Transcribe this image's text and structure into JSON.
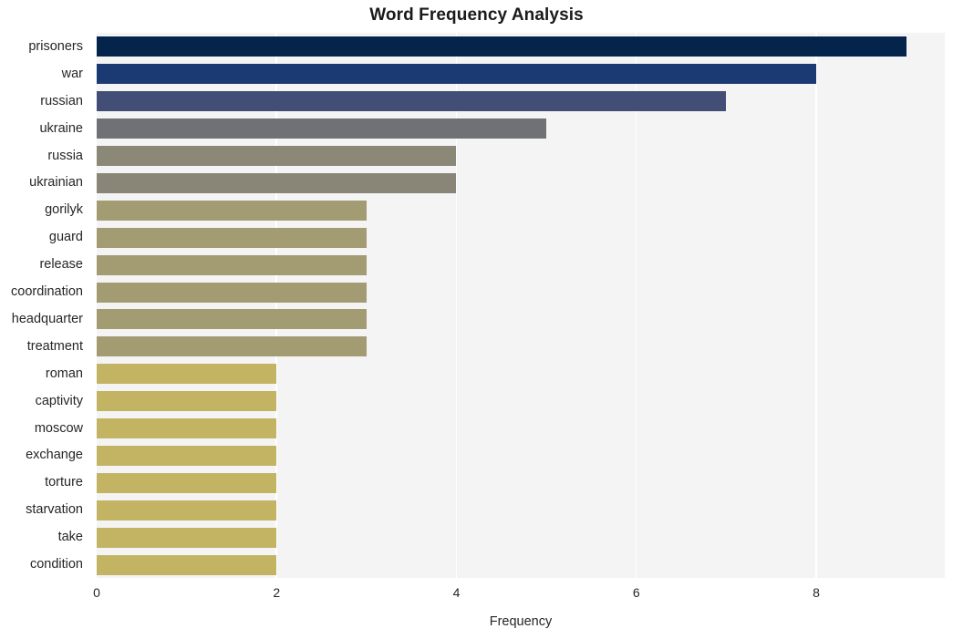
{
  "chart_data": {
    "type": "bar",
    "orientation": "horizontal",
    "title": "Word Frequency Analysis",
    "xlabel": "Frequency",
    "ylabel": "",
    "categories": [
      "prisoners",
      "war",
      "russian",
      "ukraine",
      "russia",
      "ukrainian",
      "gorilyk",
      "guard",
      "release",
      "coordination",
      "headquarter",
      "treatment",
      "roman",
      "captivity",
      "moscow",
      "exchange",
      "torture",
      "starvation",
      "take",
      "condition"
    ],
    "values": [
      9,
      8,
      7,
      5,
      4,
      4,
      3,
      3,
      3,
      3,
      3,
      3,
      2,
      2,
      2,
      2,
      2,
      2,
      2,
      2
    ],
    "bar_colors": [
      "#05244b",
      "#1b3a73",
      "#434e77",
      "#707174",
      "#8c8878",
      "#8a8677",
      "#a39b72",
      "#a39b72",
      "#a39b72",
      "#a39b72",
      "#a39b72",
      "#a39b72",
      "#c3b464",
      "#c3b464",
      "#c3b464",
      "#c3b464",
      "#c3b464",
      "#c3b464",
      "#c3b464",
      "#c3b464"
    ],
    "xticks": [
      0,
      2,
      4,
      6,
      8
    ],
    "xtick_labels": [
      "0",
      "2",
      "4",
      "6",
      "8"
    ],
    "xlim": [
      0,
      9.43
    ],
    "grid": "vertical-white",
    "plot_background": "#f4f4f5",
    "figure_background": "#ffffff",
    "legend": null
  }
}
